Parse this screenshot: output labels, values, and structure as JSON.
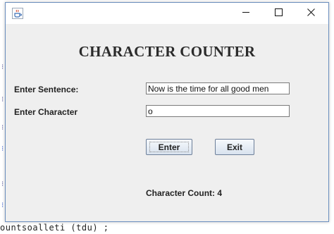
{
  "window": {
    "icon": "java-coffee-icon",
    "controls": [
      "minimize-icon",
      "maximize-icon",
      "close-icon"
    ]
  },
  "heading": "CHARACTER COUNTER",
  "form": {
    "sentence_label": "Enter Sentence:",
    "sentence_value": "Now is the time for all good men",
    "character_label": "Enter Character",
    "character_value": "o"
  },
  "buttons": {
    "enter_label": "Enter",
    "exit_label": "Exit"
  },
  "result": {
    "count_text": "Character Count: 4"
  },
  "background": {
    "code_fragment": "ountsoalleti (tdu) ;"
  },
  "colors": {
    "window_background": "#efefef",
    "titlebar": "#ffffff",
    "window_border": "#6c8fbf"
  }
}
